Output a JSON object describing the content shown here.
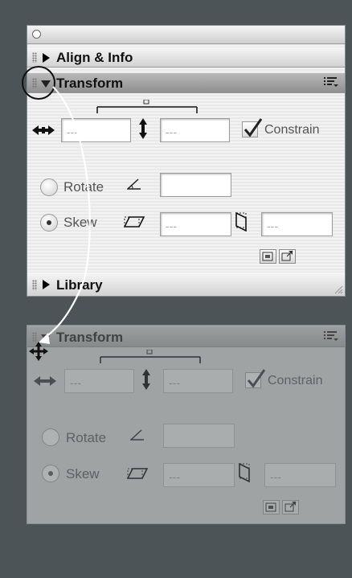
{
  "panels": {
    "align_label": "Align & Info",
    "transform_label": "Transform",
    "library_label": "Library"
  },
  "transform": {
    "width_value": "---",
    "height_value": "---",
    "constrain_label": "Constrain",
    "constrain_checked": true,
    "rotate_label": "Rotate",
    "rotate_value": "",
    "skew_label": "Skew",
    "skew_selected": true,
    "skew_h_value": "---",
    "skew_v_value": "---"
  },
  "ghost": {
    "transform_label": "Transform",
    "width_value": "---",
    "height_value": "---",
    "constrain_label": "Constrain",
    "rotate_label": "Rotate",
    "skew_label": "Skew",
    "skew_h_value": "---",
    "skew_v_value": "---"
  },
  "icons": {
    "menu": "options-menu-icon",
    "width": "horizontal-arrows-icon",
    "height": "vertical-arrows-icon",
    "rotate": "angle-icon",
    "skew_h": "skew-horizontal-icon",
    "skew_v": "skew-vertical-icon",
    "move": "move-cross-icon",
    "copy": "copy-transform-icon",
    "reset": "reset-transform-icon",
    "resize": "resize-grip-icon",
    "link": "constrain-link-icon"
  },
  "colors": {
    "background": "#4c5457",
    "panel": "#f0f0f0",
    "ghost_panel": "#9fa3a3"
  }
}
